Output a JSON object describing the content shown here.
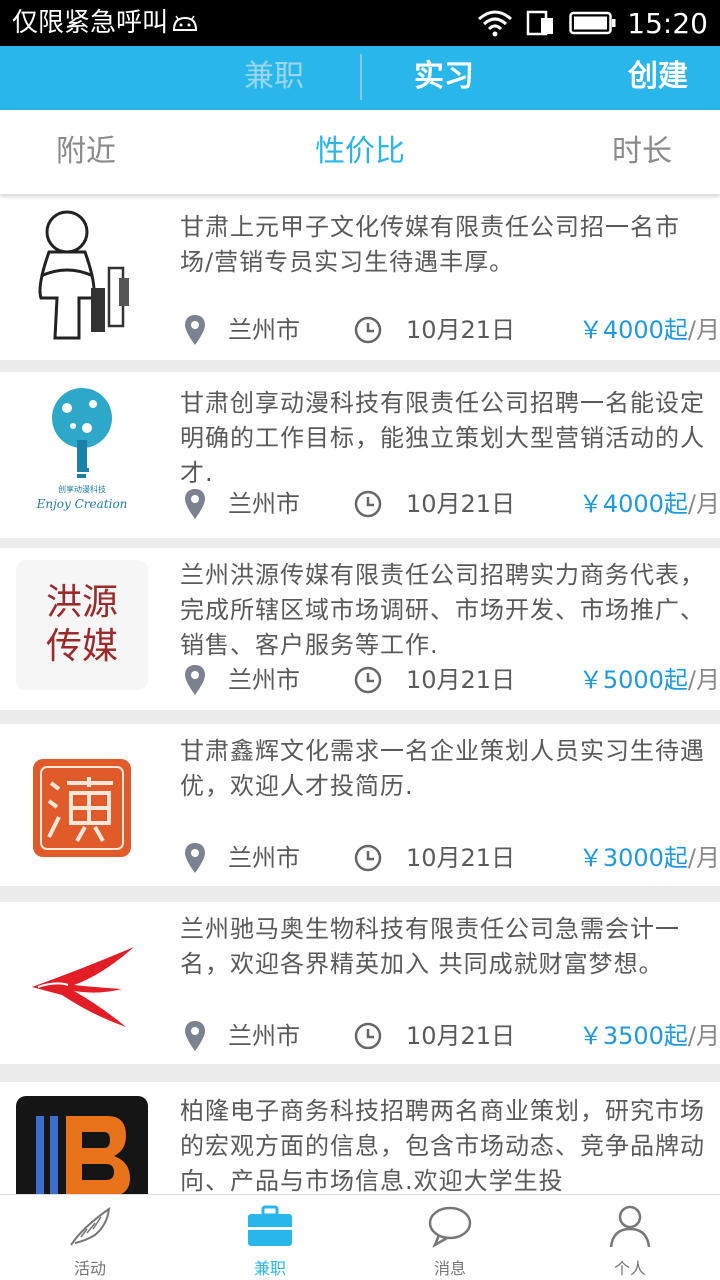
{
  "status_bar": {
    "carrier": "仅限紧急呼叫",
    "time": "15:20"
  },
  "top_bar": {
    "tab_parttime": "兼职",
    "tab_intern": "实习",
    "create": "创建"
  },
  "filters": {
    "nearby": "附近",
    "value": "性价比",
    "duration": "时长"
  },
  "jobs": [
    {
      "title": "甘肃上元甲子文化传媒有限责任公司招一名市场/营销专员实习生待遇丰厚。",
      "city": "兰州市",
      "date": "10月21日",
      "price": "￥4000起",
      "unit": "/月"
    },
    {
      "title": "甘肃创享动漫科技有限责任公司招聘一名能设定明确的工作目标，能独立策划大型营销活动的人才.",
      "city": "兰州市",
      "date": "10月21日",
      "price": "￥4000起",
      "unit": "/月",
      "logo_text": "创享动漫科技",
      "logo_caption": "Enjoy Creation"
    },
    {
      "title": "兰州洪源传媒有限责任公司招聘实力商务代表，完成所辖区域市场调研、市场开发、市场推广、销售、客户服务等工作.",
      "city": "兰州市",
      "date": "10月21日",
      "price": "￥5000起",
      "unit": "/月",
      "logo_text_1": "洪源",
      "logo_text_2": "传媒"
    },
    {
      "title": "甘肃鑫辉文化需求一名企业策划人员实习生待遇优，欢迎人才投简历.",
      "city": "兰州市",
      "date": "10月21日",
      "price": "￥3000起",
      "unit": "/月"
    },
    {
      "title": "兰州驰马奥生物科技有限责任公司急需会计一名，欢迎各界精英加入 共同成就财富梦想。",
      "city": "兰州市",
      "date": "10月21日",
      "price": "￥3500起",
      "unit": "/月"
    },
    {
      "title": "柏隆电子商务科技招聘两名商业策划，研究市场的宏观方面的信息，包含市场动态、竞争品牌动向、产品与市场信息.欢迎大学生投",
      "city": "",
      "date": "",
      "price": "",
      "unit": ""
    }
  ],
  "bottom_nav": {
    "activity": "活动",
    "parttime": "兼职",
    "messages": "消息",
    "profile": "个人"
  },
  "colors": {
    "accent": "#29b6ea",
    "price": "#1e9be0"
  }
}
